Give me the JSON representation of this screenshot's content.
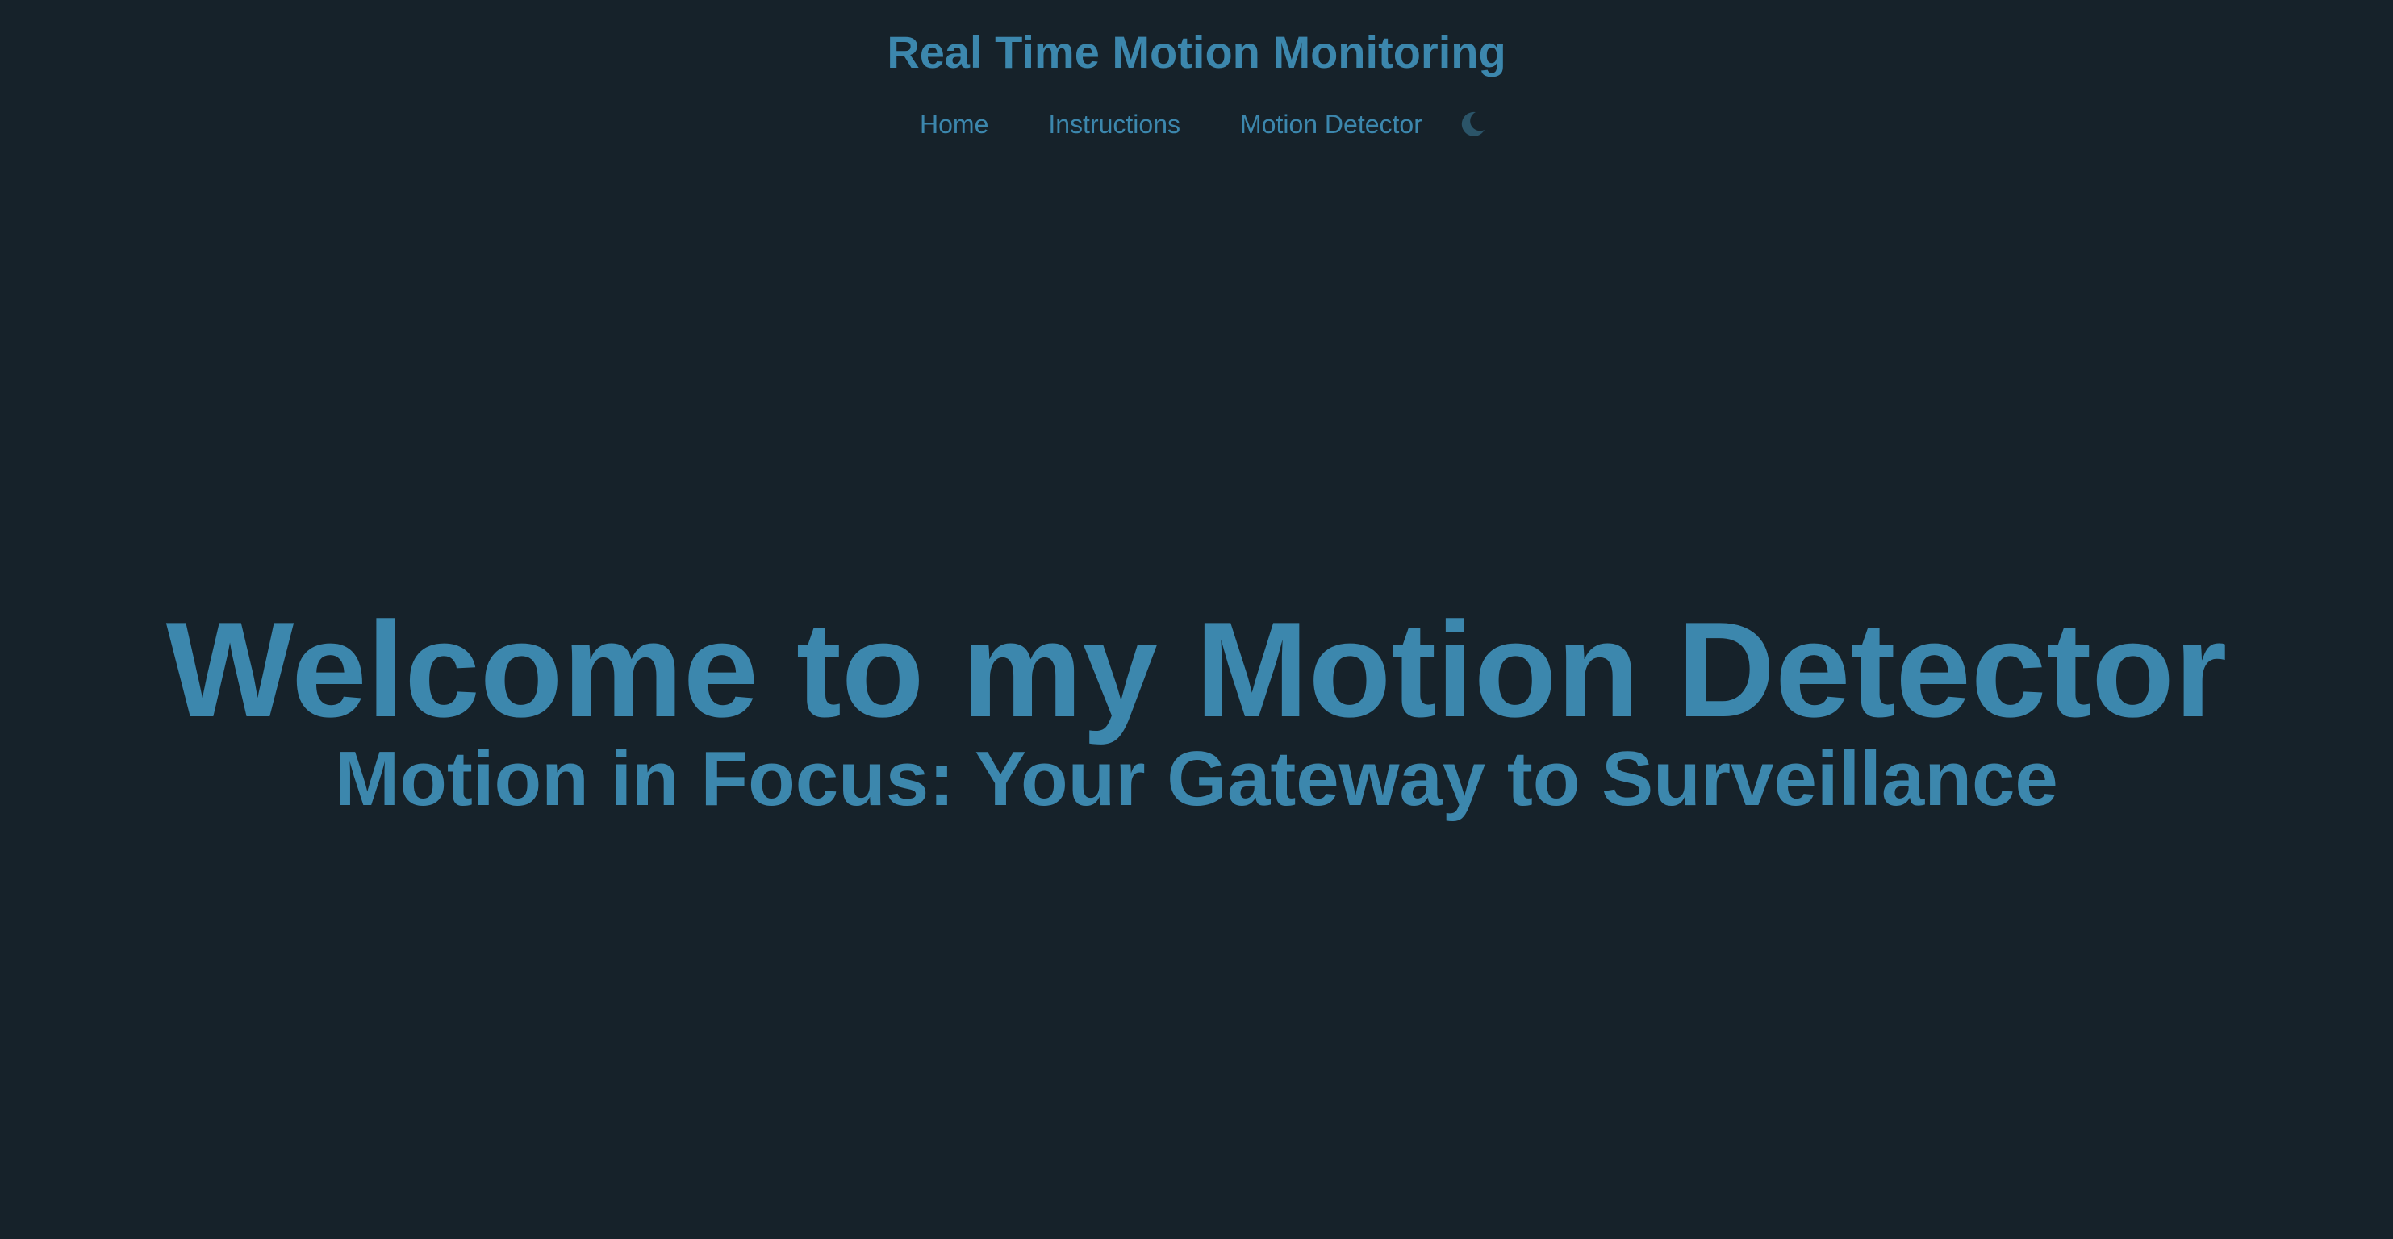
{
  "header": {
    "title": "Real Time Motion Monitoring"
  },
  "nav": {
    "items": [
      {
        "label": "Home"
      },
      {
        "label": "Instructions"
      },
      {
        "label": "Motion Detector"
      }
    ],
    "theme_toggle_icon": "moon-icon"
  },
  "hero": {
    "title": "Welcome to my Motion Detector",
    "subtitle": "Motion in Focus: Your Gateway to Surveillance"
  },
  "colors": {
    "background": "#16222a",
    "accent": "#3c87ad",
    "icon": "#2b5468"
  }
}
